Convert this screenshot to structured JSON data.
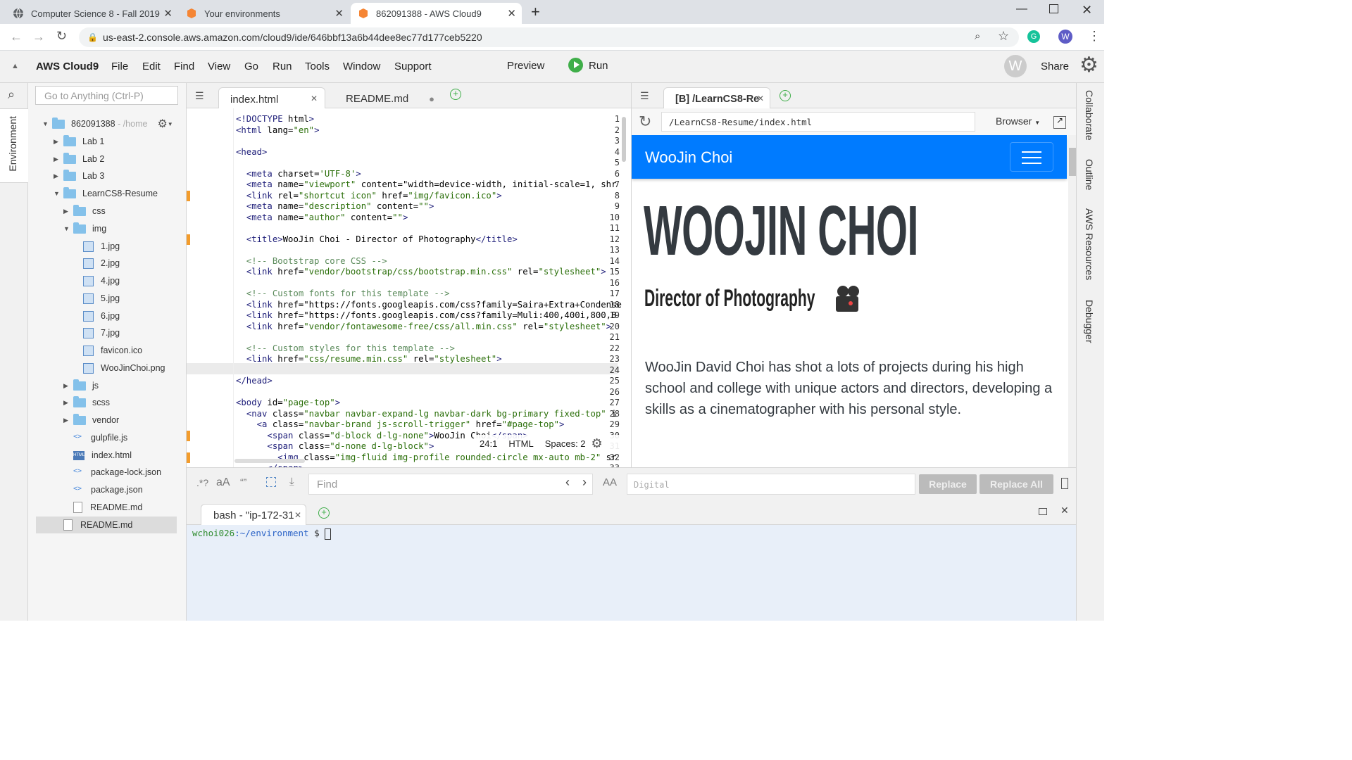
{
  "browser": {
    "tabs": [
      {
        "title": "Computer Science 8 - Fall 2019"
      },
      {
        "title": "Your environments"
      },
      {
        "title": "862091388 - AWS Cloud9"
      }
    ],
    "url": "us-east-2.console.aws.amazon.com/cloud9/ide/646bbf13a6b44dee8ec77d177ceb5220",
    "profile_initial": "W"
  },
  "menubar": {
    "brand": "AWS Cloud9",
    "items": [
      "File",
      "Edit",
      "Find",
      "View",
      "Go",
      "Run",
      "Tools",
      "Window",
      "Support"
    ],
    "preview": "Preview",
    "run": "Run",
    "share": "Share",
    "avatar": "W"
  },
  "sidebar": {
    "search_placeholder": "Go to Anything (Ctrl-P)",
    "environment_label": "Environment"
  },
  "tree": {
    "root": "862091388",
    "root_path": "- /home",
    "items": [
      {
        "name": "Lab 1"
      },
      {
        "name": "Lab 2"
      },
      {
        "name": "Lab 3"
      },
      {
        "name": "LearnCS8-Resume"
      },
      {
        "name": "css"
      },
      {
        "name": "img"
      },
      {
        "name": "1.jpg"
      },
      {
        "name": "2.jpg"
      },
      {
        "name": "4.jpg"
      },
      {
        "name": "5.jpg"
      },
      {
        "name": "6.jpg"
      },
      {
        "name": "7.jpg"
      },
      {
        "name": "favicon.ico"
      },
      {
        "name": "WooJinChoi.png"
      },
      {
        "name": "js"
      },
      {
        "name": "scss"
      },
      {
        "name": "vendor"
      },
      {
        "name": "gulpfile.js"
      },
      {
        "name": "index.html"
      },
      {
        "name": "package-lock.json"
      },
      {
        "name": "package.json"
      },
      {
        "name": "README.md"
      },
      {
        "name": "README.md"
      }
    ]
  },
  "editor": {
    "tabs": [
      {
        "label": "index.html"
      },
      {
        "label": "README.md"
      }
    ],
    "lines": [
      "<!DOCTYPE html>",
      "<html lang=\"en\">",
      "",
      "<head>",
      "",
      "  <meta charset='UTF-8'>",
      "  <meta name=\"viewport\" content=\"width=device-width, initial-scale=1, shr",
      "  <link rel=\"shortcut icon\" href=\"img/favicon.ico\">",
      "  <meta name=\"description\" content=\"\">",
      "  <meta name=\"author\" content=\"\">",
      "",
      "  <title>WooJin Choi - Director of Photography</title>",
      "",
      "  <!-- Bootstrap core CSS -->",
      "  <link href=\"vendor/bootstrap/css/bootstrap.min.css\" rel=\"stylesheet\">",
      "",
      "  <!-- Custom fonts for this template -->",
      "  <link href=\"https://fonts.googleapis.com/css?family=Saira+Extra+Condense",
      "  <link href=\"https://fonts.googleapis.com/css?family=Muli:400,400i,800,8",
      "  <link href=\"vendor/fontawesome-free/css/all.min.css\" rel=\"stylesheet\">",
      "",
      "  <!-- Custom styles for this template -->",
      "  <link href=\"css/resume.min.css\" rel=\"stylesheet\">",
      "",
      "</head>",
      "",
      "<body id=\"page-top\">",
      "  <nav class=\"navbar navbar-expand-lg navbar-dark bg-primary fixed-top\" i",
      "    <a class=\"navbar-brand js-scroll-trigger\" href=\"#page-top\">",
      "      <span class=\"d-block d-lg-none\">WooJin Choi</span>",
      "      <span class=\"d-none d-lg-block\">",
      "        <img class=\"img-fluid img-profile rounded-circle mx-auto mb-2\" sr",
      "      </span>"
    ],
    "status": {
      "position": "24:1",
      "mode": "HTML",
      "spaces": "Spaces: 2"
    }
  },
  "find": {
    "placeholder": "Find",
    "replace_value": "Digital",
    "replace": "Replace",
    "replace_all": "Replace All"
  },
  "terminal": {
    "tab": "bash - \"ip-172-31",
    "prompt_user": "wchoi026",
    "prompt_path": ":~/environment",
    "prompt_sign": "$"
  },
  "preview": {
    "tab": "[B] /LearnCS8-Re",
    "url": "/LearnCS8-Resume/index.html",
    "browser_label": "Browser",
    "navbar_brand": "WooJin Choi",
    "name": "WOOJIN CHOI",
    "subtitle": "Director of Photography",
    "paragraph": "WooJin David Choi has shot a lots of projects during his high school and college with unique actors and directors, developing a skills as a cinematographer with his personal style."
  },
  "rightbar": [
    "Collaborate",
    "Outline",
    "AWS Resources",
    "Debugger"
  ],
  "colors": {
    "accent": "#007bff",
    "marker": "#f39c2c",
    "run_green": "#3fae49"
  }
}
